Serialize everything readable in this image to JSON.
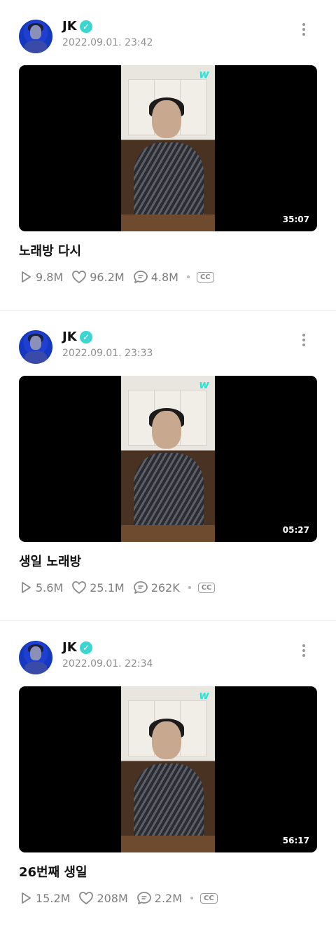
{
  "posts": [
    {
      "author": "JK",
      "date": "2022.09.01. 23:42",
      "watermark": "w",
      "duration": "35:07",
      "title": "노래방 다시",
      "plays": "9.8M",
      "likes": "96.2M",
      "comments": "4.8M",
      "cc": "CC"
    },
    {
      "author": "JK",
      "date": "2022.09.01. 23:33",
      "watermark": "w",
      "duration": "05:27",
      "title": "생일 노래방",
      "plays": "5.6M",
      "likes": "25.1M",
      "comments": "262K",
      "cc": "CC"
    },
    {
      "author": "JK",
      "date": "2022.09.01. 22:34",
      "watermark": "w",
      "duration": "56:17",
      "title": "26번째 생일",
      "plays": "15.2M",
      "likes": "208M",
      "comments": "2.2M",
      "cc": "CC"
    }
  ],
  "icons": {
    "verified": "verified-badge-icon",
    "more": "more-vertical-icon",
    "play": "play-icon",
    "like": "heart-icon",
    "comment": "comment-icon"
  },
  "colors": {
    "verified": "#3ad6cf",
    "watermark": "#32e0d6",
    "meta": "#8e8e8e"
  }
}
